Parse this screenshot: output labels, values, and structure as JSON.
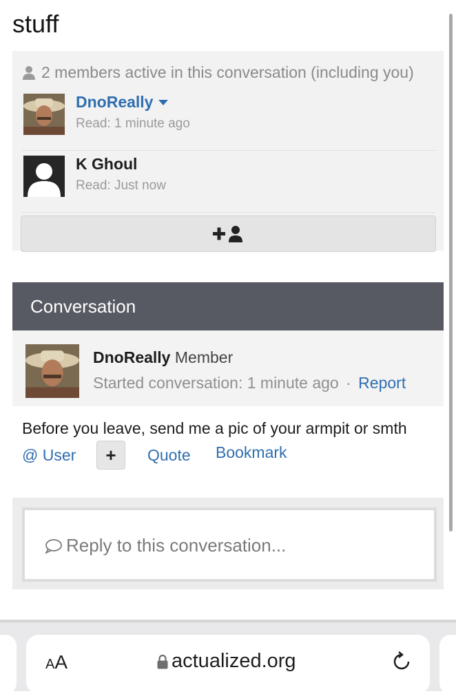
{
  "page": {
    "title": "stuff"
  },
  "members": {
    "heading": "2 members active in this conversation (including you)",
    "list": [
      {
        "name": "DnoReally",
        "read": "Read: 1 minute ago"
      },
      {
        "name": "K Ghoul",
        "read": "Read: Just now"
      }
    ],
    "invite_icon": "add-user-icon"
  },
  "conversation": {
    "header": "Conversation",
    "message": {
      "author": "DnoReally",
      "role": "Member",
      "started": "Started conversation: 1 minute ago",
      "separator": "·",
      "report": "Report",
      "body": "Before you leave, send me a pic of your armpit or smth",
      "actions": {
        "user": "@ User",
        "plus": "+",
        "quote": "Quote",
        "bookmark": "Bookmark"
      }
    },
    "reply_placeholder": "Reply to this conversation..."
  },
  "browser": {
    "text_size_small": "A",
    "text_size_big": "A",
    "url": "actualized.org"
  },
  "colors": {
    "link": "#2f6eb0",
    "header_bg": "#575a63",
    "panel_bg": "#f2f2f2"
  }
}
